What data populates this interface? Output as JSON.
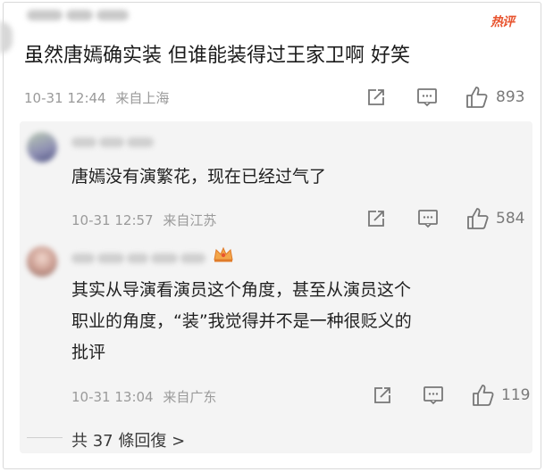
{
  "comment": {
    "hot_badge": "热评",
    "text": "虽然唐嫣确实装 但谁能装得过王家卫啊 好笑",
    "time": "10-31 12:44",
    "location": "来自上海",
    "likes": "893"
  },
  "replies": [
    {
      "text": "唐嫣没有演繁花，现在已经过气了",
      "time": "10-31 12:57",
      "location": "来自江苏",
      "likes": "584"
    },
    {
      "text_line1": "其实从导演看演员这个角度，甚至从演员这个",
      "text_line2": "职业的角度，“装”我觉得并不是一种很贬义的",
      "text_line3": "批评",
      "time": "10-31 13:04",
      "location": "来自广东",
      "likes": "119"
    }
  ],
  "more_replies": "共 37 條回復 >",
  "icons": [
    "share-icon",
    "comment-icon",
    "like-icon",
    "crown-badge-icon"
  ]
}
